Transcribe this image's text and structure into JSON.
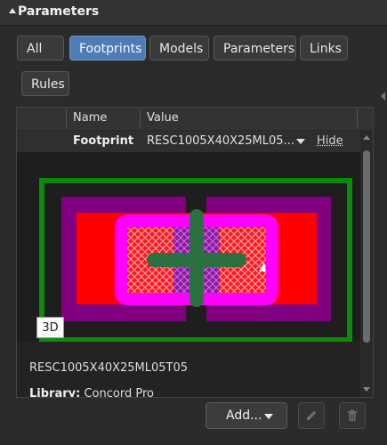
{
  "panel": {
    "title": "Parameters"
  },
  "filters": [
    "All",
    "Footprints",
    "Models",
    "Parameters",
    "Links",
    "Rules"
  ],
  "active_filter": "Footprints",
  "table": {
    "headers": [
      "Name",
      "Value"
    ],
    "row": {
      "name": "Footprint",
      "value": "RESC1005X40X25ML05...",
      "action": "Hide"
    }
  },
  "preview": {
    "badge": "3D"
  },
  "details": {
    "part": "RESC1005X40X25ML05T05",
    "library_label": "Library:",
    "library": "Concord Pro"
  },
  "footer": {
    "add_label": "Add..."
  },
  "icons": {
    "edit": "pencil-icon",
    "delete": "trash-icon",
    "header": "collapse-triangle-icon"
  }
}
